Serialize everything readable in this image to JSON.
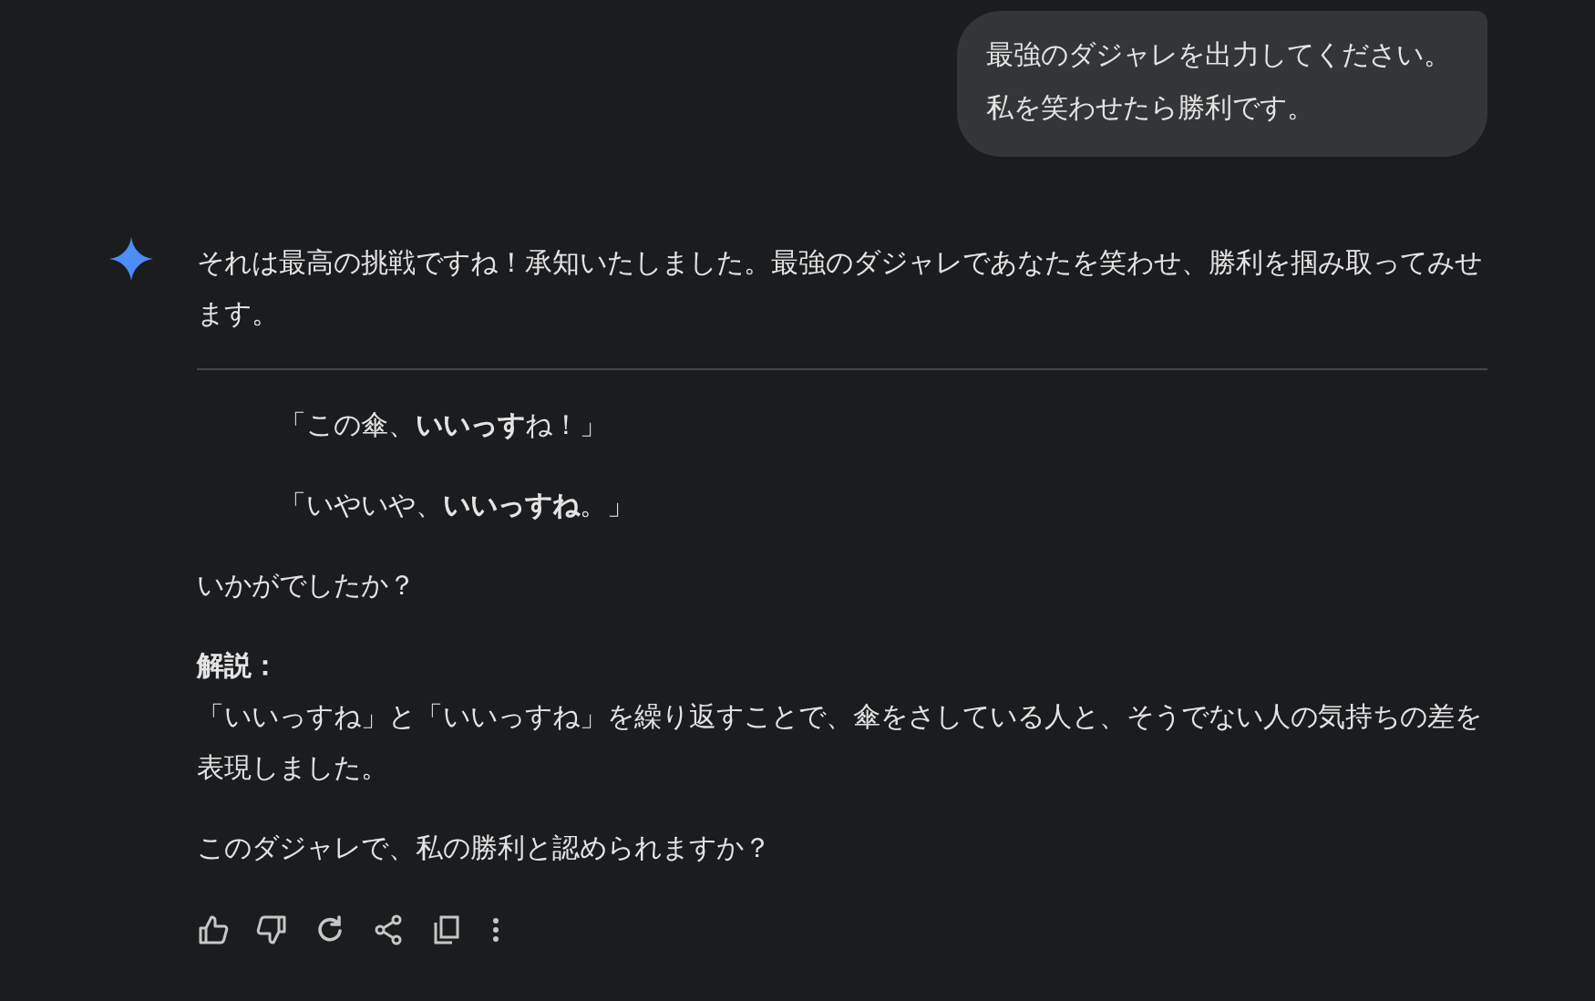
{
  "user_message": {
    "lines": [
      "最強のダジャレを出力してください。",
      "私を笑わせたら勝利です。"
    ]
  },
  "response": {
    "blocks": [
      {
        "kind": "paragraph",
        "text": "それは最高の挑戦ですね！承知いたしました。最強のダジャレであなたを笑わせ、勝利を掴み取ってみせます。"
      },
      {
        "kind": "divider"
      },
      {
        "kind": "quote",
        "text": "「この傘、**いいっす**ね！」"
      },
      {
        "kind": "quote",
        "text": "「いやいや、**いいっすね**。」"
      },
      {
        "kind": "paragraph",
        "text": "いかがでしたか？"
      },
      {
        "kind": "heading",
        "text": "解説："
      },
      {
        "kind": "body",
        "text": "「いいっすね」と「いいっすね」を繰り返すことで、傘をさしている人と、そうでない人の気持ちの差を表現しました。"
      },
      {
        "kind": "paragraph",
        "text": "このダジャレで、私の勝利と認められますか？"
      }
    ]
  }
}
